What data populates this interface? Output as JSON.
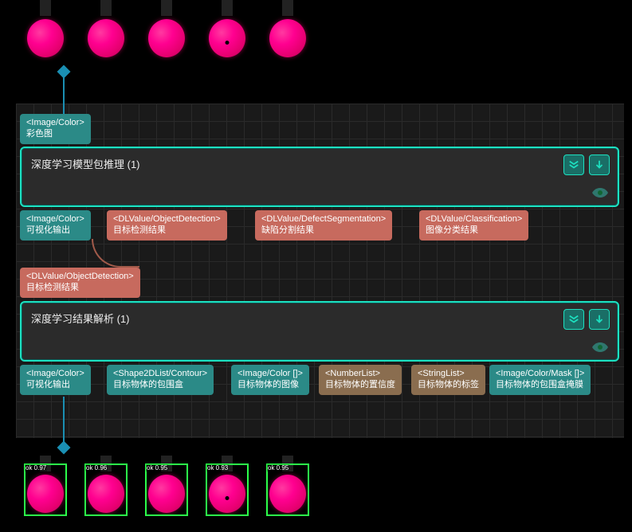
{
  "top_input": {
    "type": "<Image/Color>",
    "label": "彩色图"
  },
  "node1": {
    "title": "深度学习模型包推理 (1)",
    "out_ports": [
      {
        "type": "<Image/Color>",
        "label": "可视化输出",
        "color": "teal"
      },
      {
        "type": "<DLValue/ObjectDetection>",
        "label": "目标检测结果",
        "color": "salmon"
      },
      {
        "type": "<DLValue/DefectSegmentation>",
        "label": "缺陷分割结果",
        "color": "salmon"
      },
      {
        "type": "<DLValue/Classification>",
        "label": "图像分类结果",
        "color": "salmon"
      }
    ]
  },
  "mid_port": {
    "type": "<DLValue/ObjectDetection>",
    "label": "目标检测结果"
  },
  "node2": {
    "title": "深度学习结果解析 (1)",
    "out_ports": [
      {
        "type": "<Image/Color>",
        "label": "可视化输出",
        "color": "teal"
      },
      {
        "type": "<Shape2DList/Contour>",
        "label": "目标物体的包围盒",
        "color": "teal"
      },
      {
        "type": "<Image/Color []>",
        "label": "目标物体的图像",
        "color": "teal"
      },
      {
        "type": "<NumberList>",
        "label": "目标物体的置信度",
        "color": "brown"
      },
      {
        "type": "<StringList>",
        "label": "目标物体的标签",
        "color": "brown"
      },
      {
        "type": "<Image/Color/Mask []>",
        "label": "目标物体的包围盒掩膜",
        "color": "teal"
      }
    ]
  },
  "detections": [
    {
      "label": "ok 0.97"
    },
    {
      "label": "ok 0.96"
    },
    {
      "label": "ok 0.95"
    },
    {
      "label": "ok 0.93"
    },
    {
      "label": "ok 0.95"
    }
  ]
}
